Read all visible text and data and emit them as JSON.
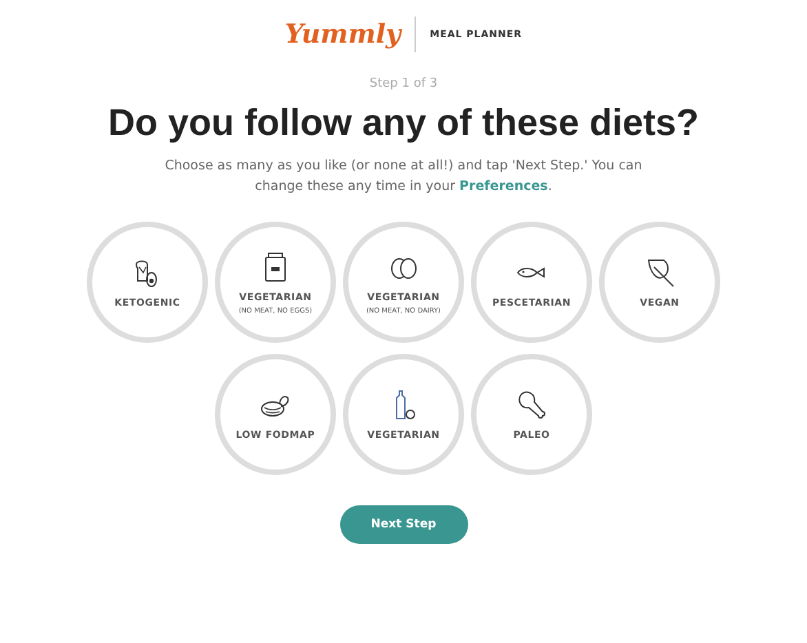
{
  "header": {
    "logo": "Yummly",
    "product": "MEAL PLANNER"
  },
  "step": "Step 1 of 3",
  "title": "Do you follow any of these diets?",
  "intro": "Choose as many as you like (or none at all!) and tap 'Next Step.' You can change these any time in your ",
  "preferences_link": "Preferences",
  "intro_end": ".",
  "diets": [
    {
      "kind": "keto",
      "label": "KETOGENIC",
      "selected": false
    },
    {
      "kind": "jar",
      "label": "VEGETARIAN",
      "note": "(NO MEAT, NO EGGS)",
      "selected": false
    },
    {
      "kind": "eggs",
      "label": "VEGETARIAN",
      "note": "(NO MEAT, NO DAIRY)",
      "selected": false
    },
    {
      "kind": "fish",
      "label": "PESCETARIAN",
      "selected": false
    },
    {
      "kind": "leaf",
      "label": "VEGAN",
      "selected": false
    },
    {
      "kind": "bowl",
      "label": "LOW FODMAP",
      "selected": false
    },
    {
      "kind": "milk",
      "label": "VEGETARIAN",
      "selected": false
    },
    {
      "kind": "drumstick",
      "label": "PALEO",
      "selected": false
    }
  ],
  "next_button": "Next Step"
}
